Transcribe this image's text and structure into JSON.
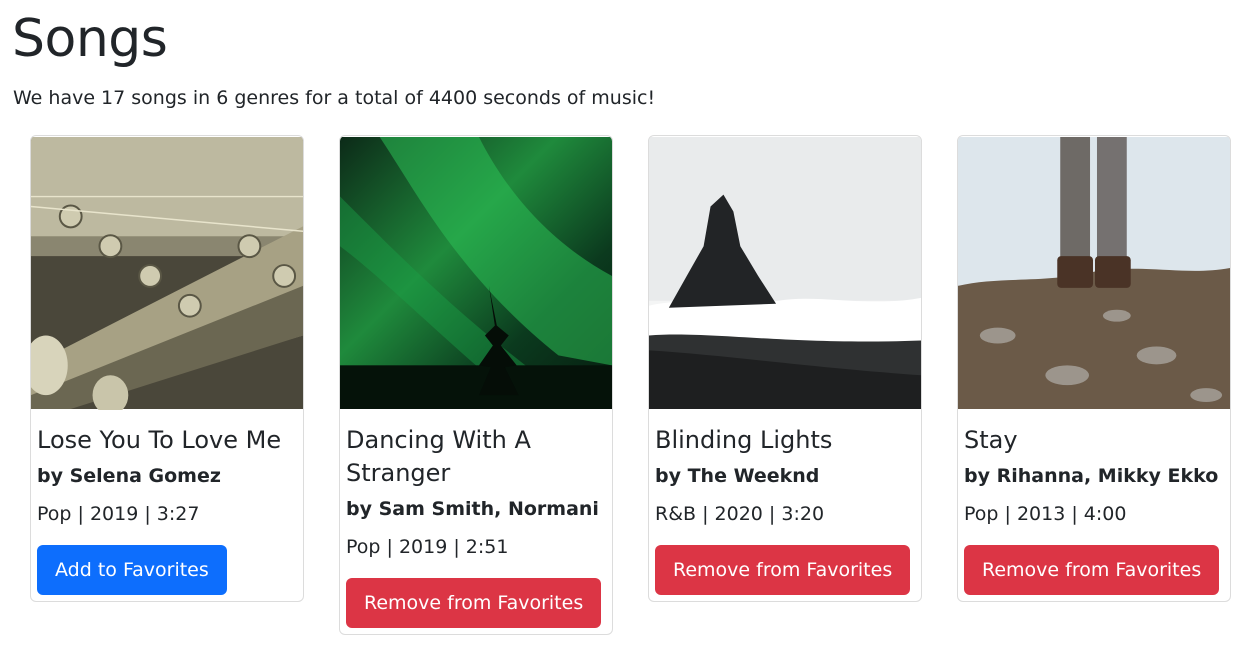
{
  "page": {
    "title": "Songs",
    "summary": "We have 17 songs in 6 genres for a total of 4400 seconds of music!"
  },
  "songs": [
    {
      "title": "Lose You To Love Me",
      "artist": "by Selena Gomez",
      "meta": "Pop | 2019 | 3:27",
      "button": "Add to Favorites",
      "image": "guitar-headstock-photo"
    },
    {
      "title": "Dancing With A Stranger",
      "artist": "by Sam Smith, Normani",
      "meta": "Pop | 2019 | 2:51",
      "button": "Remove from Favorites",
      "image": "aurora-tree-photo"
    },
    {
      "title": "Blinding Lights",
      "artist": "by The Weeknd",
      "meta": "R&B | 2020 | 3:20",
      "button": "Remove from Favorites",
      "image": "sea-rock-beach-photo"
    },
    {
      "title": "Stay",
      "artist": "by Rihanna, Mikky Ekko",
      "meta": "Pop | 2013 | 4:00",
      "button": "Remove from Favorites",
      "image": "legs-on-rocks-photo"
    }
  ],
  "colors": {
    "add_button": "#0d6efd",
    "remove_button": "#dc3545",
    "text": "#212529",
    "card_border": "#dcdcdc"
  }
}
